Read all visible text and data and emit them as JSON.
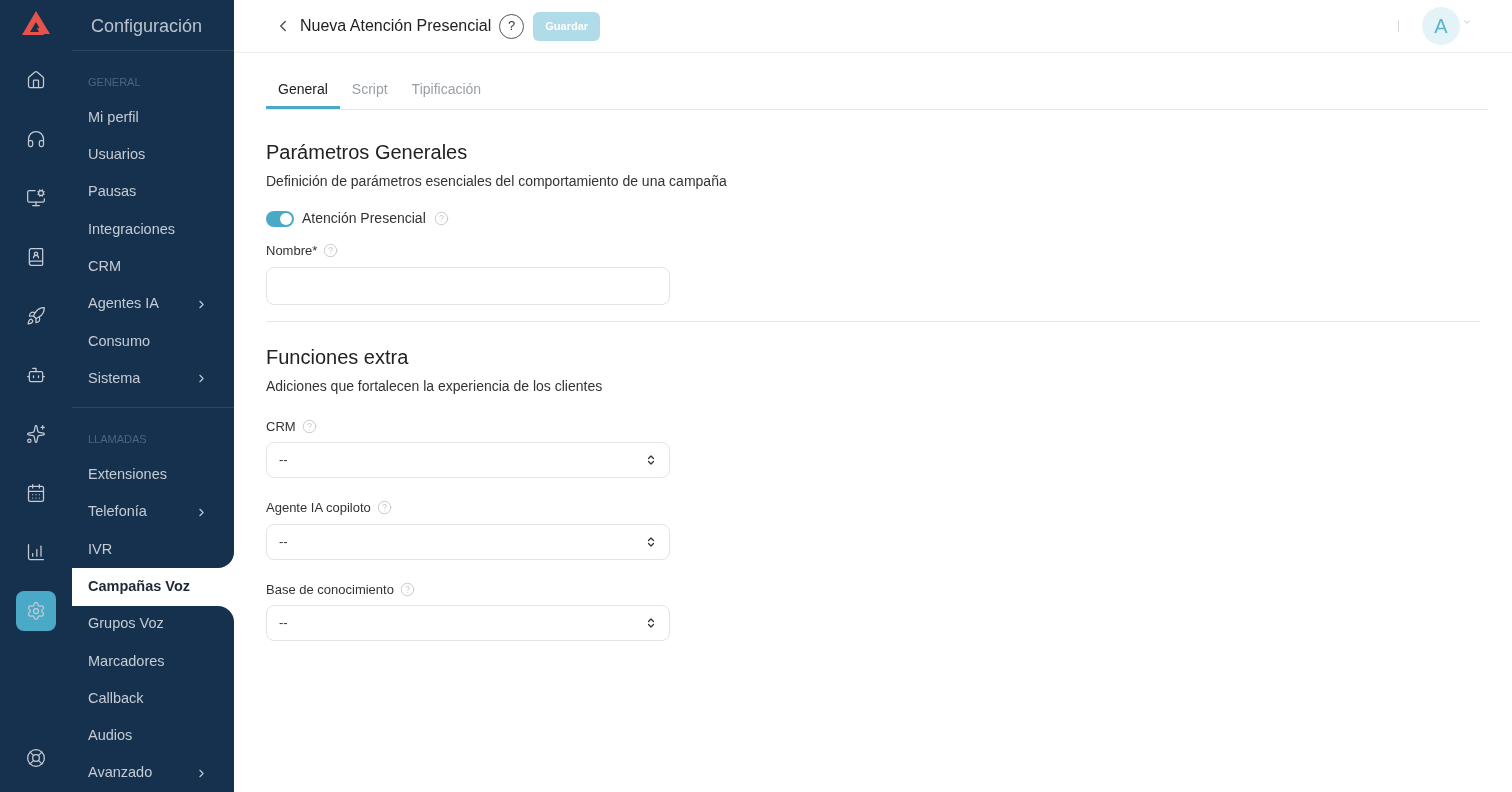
{
  "rail": {
    "items": [
      {
        "selected": false
      },
      {
        "selected": false
      },
      {
        "selected": false
      },
      {
        "selected": false
      },
      {
        "selected": false
      },
      {
        "selected": false
      },
      {
        "selected": false
      },
      {
        "selected": false
      },
      {
        "selected": false
      },
      {
        "selected": true
      }
    ]
  },
  "sidebar": {
    "title": "Configuración",
    "sections": [
      {
        "title": "GENERAL",
        "items": [
          {
            "label": "Mi perfil",
            "expandable": false,
            "selected": false
          },
          {
            "label": "Usuarios",
            "expandable": false,
            "selected": false
          },
          {
            "label": "Pausas",
            "expandable": false,
            "selected": false
          },
          {
            "label": "Integraciones",
            "expandable": false,
            "selected": false
          },
          {
            "label": "CRM",
            "expandable": false,
            "selected": false
          },
          {
            "label": "Agentes IA",
            "expandable": true,
            "selected": false
          },
          {
            "label": "Consumo",
            "expandable": false,
            "selected": false
          },
          {
            "label": "Sistema",
            "expandable": true,
            "selected": false
          }
        ]
      },
      {
        "title": "LLAMADAS",
        "items": [
          {
            "label": "Extensiones",
            "expandable": false,
            "selected": false
          },
          {
            "label": "Telefonía",
            "expandable": true,
            "selected": false
          },
          {
            "label": "IVR",
            "expandable": false,
            "selected": false
          },
          {
            "label": "Campañas Voz",
            "expandable": false,
            "selected": true
          },
          {
            "label": "Grupos Voz",
            "expandable": false,
            "selected": false
          },
          {
            "label": "Marcadores",
            "expandable": false,
            "selected": false
          },
          {
            "label": "Callback",
            "expandable": false,
            "selected": false
          },
          {
            "label": "Audios",
            "expandable": false,
            "selected": false
          },
          {
            "label": "Avanzado",
            "expandable": true,
            "selected": false
          }
        ]
      }
    ]
  },
  "header": {
    "title": "Nueva Atención Presencial",
    "help": "?",
    "save_button": {
      "label": "Guardar",
      "disabled": true
    },
    "avatar": "A"
  },
  "tabs": [
    {
      "label": "General",
      "selected": true
    },
    {
      "label": "Script",
      "selected": false
    },
    {
      "label": "Tipificación",
      "selected": false
    }
  ],
  "sections": [
    {
      "title": "Parámetros Generales",
      "description": "Definición de parámetros esenciales del comportamiento de una campaña",
      "fields": [
        {
          "kind": "toggle",
          "label": "Atención Presencial",
          "on": true
        },
        {
          "kind": "text",
          "label": "Nombre*"
        }
      ]
    },
    {
      "title": "Funciones extra",
      "description": "Adiciones que fortalecen la experiencia de los clientes",
      "fields": [
        {
          "kind": "select",
          "label": "CRM",
          "value": "--"
        },
        {
          "kind": "select",
          "label": "Agente IA copiloto",
          "value": "--"
        },
        {
          "kind": "select",
          "label": "Base de conocimiento",
          "value": "--"
        }
      ]
    }
  ]
}
